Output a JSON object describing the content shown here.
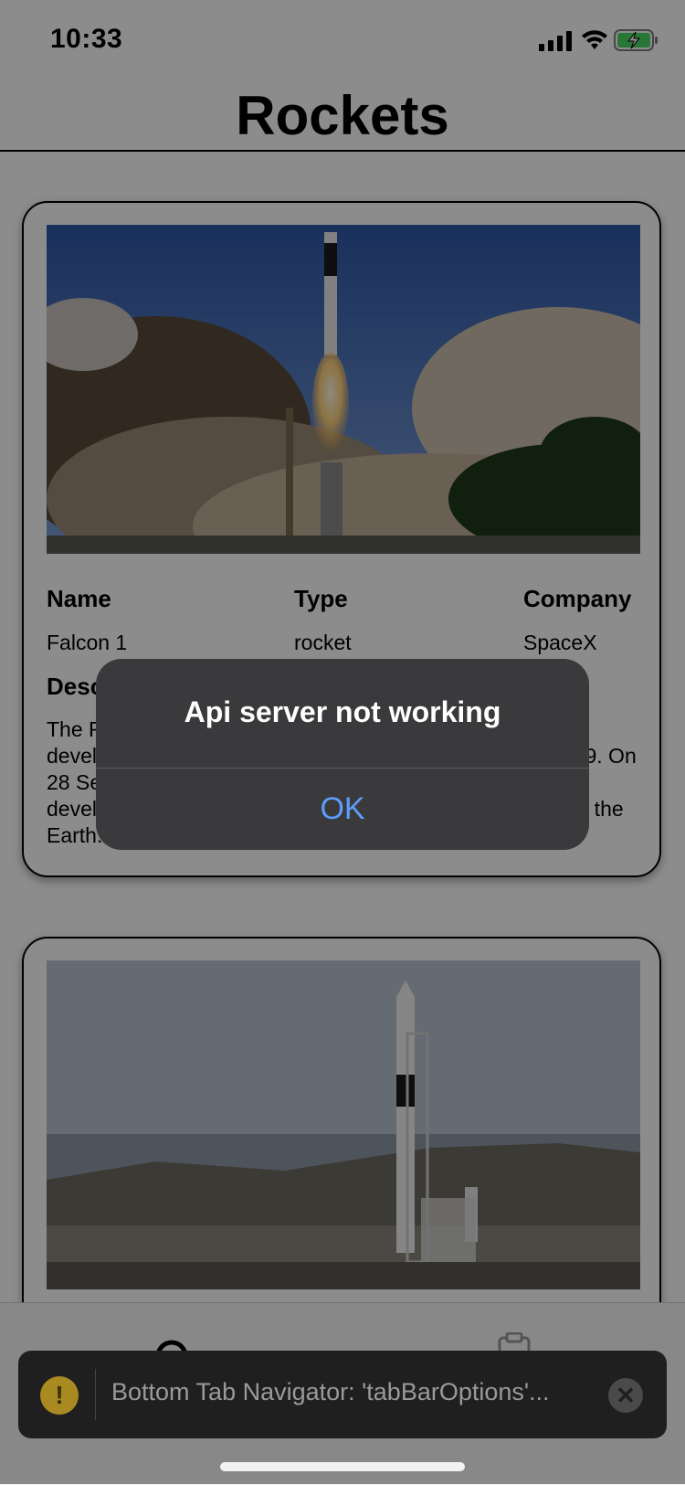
{
  "status_bar": {
    "time": "10:33"
  },
  "header": {
    "title": "Rockets"
  },
  "cards": [
    {
      "name_label": "Name",
      "type_label": "Type",
      "company_label": "Company",
      "name": "Falcon 1",
      "type": "rocket",
      "company": "SpaceX",
      "description_label": "Description",
      "description": "The Falcon 1 was an expendable launch system privately developed and manufactured by SpaceX during 2006-2009. On 28 September 2008, Falcon 1 became the first privately-developed liquid-fuel launch vehicle to go into orbit around the Earth."
    },
    {
      "image": "falcon-9-on-launch-pad"
    }
  ],
  "alert": {
    "title": "Api server not working",
    "ok_label": "OK"
  },
  "toast": {
    "text": "Bottom Tab Navigator: 'tabBarOptions'...",
    "warning_glyph": "!",
    "close_glyph": "✕"
  },
  "tab_bar": {
    "items": [
      {
        "icon": "rocket-tab-icon"
      },
      {
        "icon": "clipboard-tab-icon"
      }
    ]
  },
  "colors": {
    "alert_bg": "#3a3a3c",
    "alert_button": "#5d9cf8",
    "toast_bg": "#1f1f1f",
    "warning": "#a98a21"
  }
}
